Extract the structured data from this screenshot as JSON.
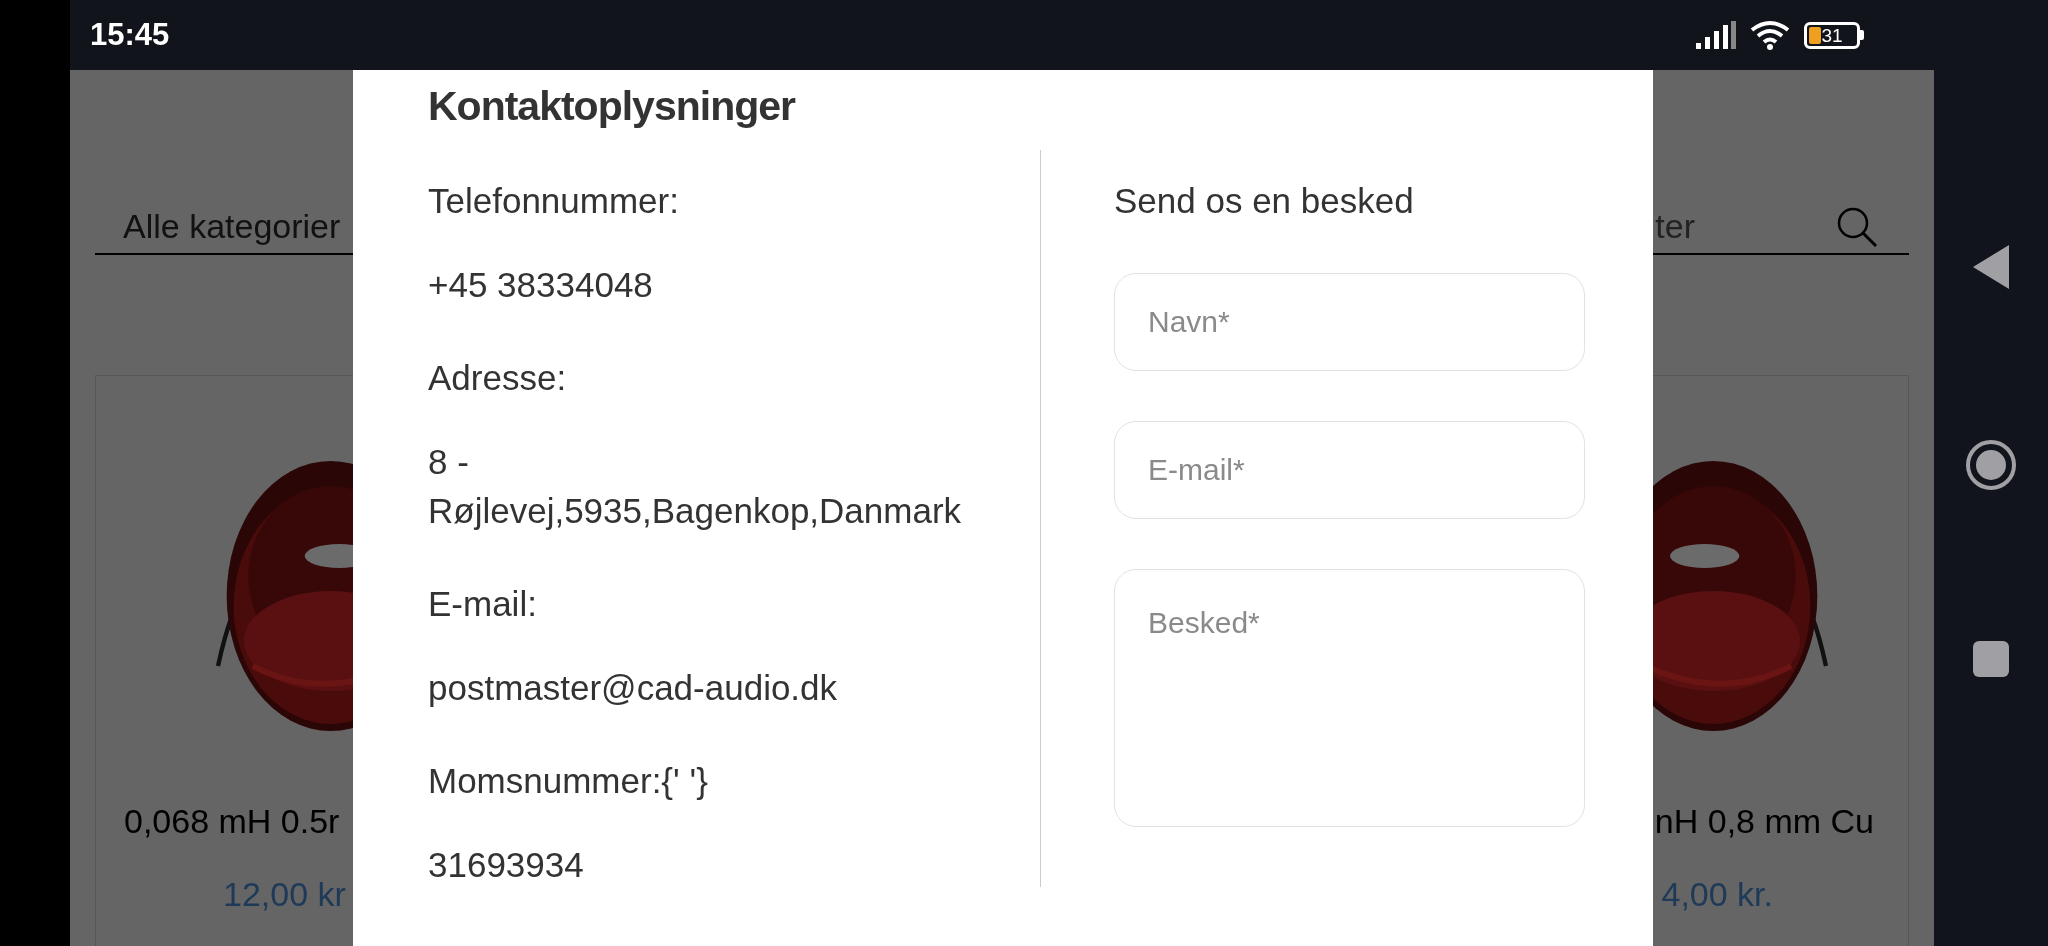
{
  "status_bar": {
    "time": "15:45",
    "battery": "31"
  },
  "background_page": {
    "category_select": "Alle kategorier",
    "search_text": "ter",
    "products": [
      {
        "name": "0,068 mH 0.5r",
        "price": "12,00 kr"
      },
      {
        "name": "nH 0,8 mm Cu",
        "price": "4,00 kr."
      }
    ]
  },
  "modal": {
    "title": "Kontaktoplysninger",
    "details": [
      {
        "label": "Telefonnummer:",
        "value": "+45 38334048"
      },
      {
        "label": "Adresse:",
        "value": "8 - Røjlevej,5935,Bagenkop,Danmark"
      },
      {
        "label": "E-mail:",
        "value": "postmaster@cad-audio.dk"
      },
      {
        "label": "Momsnummer:{' '}",
        "value": "31693934"
      }
    ],
    "form": {
      "heading": "Send os en besked",
      "fields": [
        {
          "kind": "input",
          "placeholder": "Navn*"
        },
        {
          "kind": "input",
          "placeholder": "E-mail*"
        },
        {
          "kind": "textarea",
          "placeholder": "Besked*"
        }
      ]
    }
  }
}
